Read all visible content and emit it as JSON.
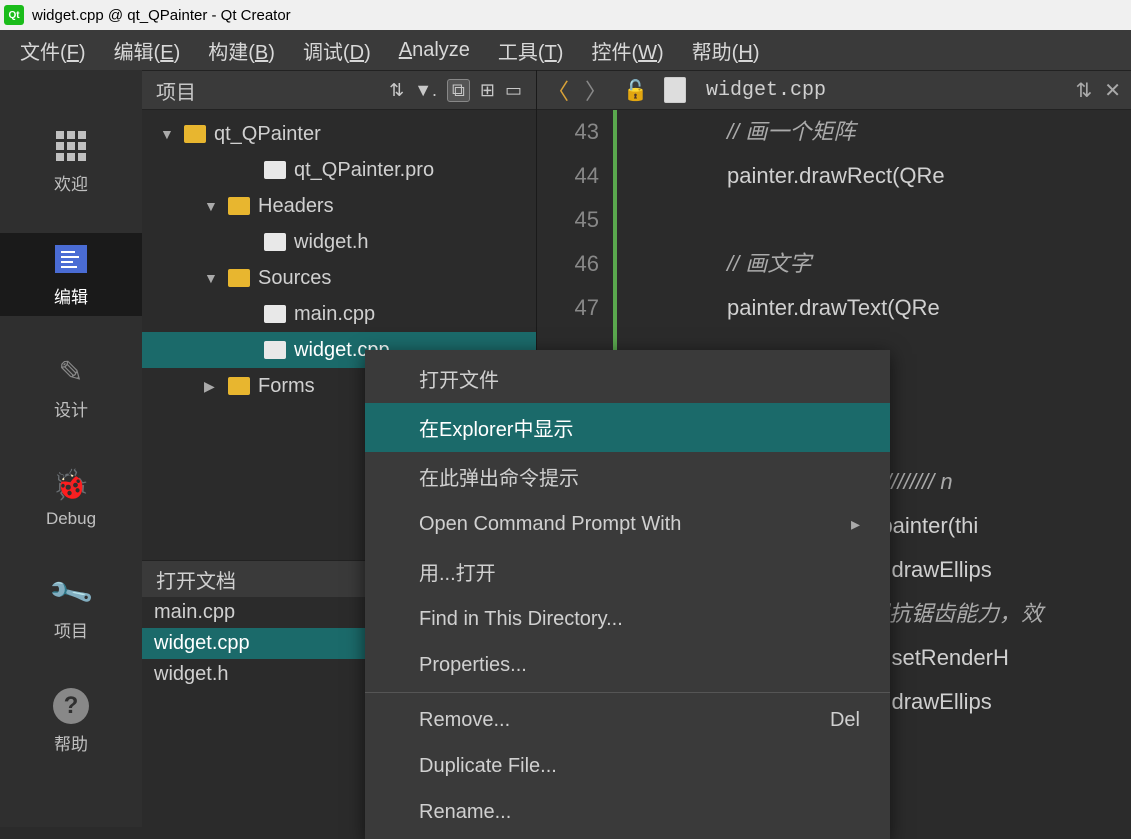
{
  "titlebar": {
    "text": "widget.cpp @ qt_QPainter - Qt Creator",
    "app_badge": "Qt"
  },
  "menubar": [
    {
      "label": "文件(F)",
      "u": "F"
    },
    {
      "label": "编辑(E)",
      "u": "E"
    },
    {
      "label": "构建(B)",
      "u": "B"
    },
    {
      "label": "调试(D)",
      "u": "D"
    },
    {
      "label": "Analyze",
      "u": "A"
    },
    {
      "label": "工具(T)",
      "u": "T"
    },
    {
      "label": "控件(W)",
      "u": "W"
    },
    {
      "label": "帮助(H)",
      "u": "H"
    }
  ],
  "sidebar": [
    {
      "id": "welcome",
      "label": "欢迎"
    },
    {
      "id": "edit",
      "label": "编辑"
    },
    {
      "id": "design",
      "label": "设计"
    },
    {
      "id": "debug",
      "label": "Debug"
    },
    {
      "id": "project",
      "label": "项目"
    },
    {
      "id": "help",
      "label": "帮助"
    }
  ],
  "sidebar_active": "edit",
  "project_panel": {
    "title": "项目",
    "tree": [
      {
        "level": 0,
        "arrow": "▼",
        "icon": "project",
        "color": "#e8b62f",
        "name": "qt_QPainter"
      },
      {
        "level": 2,
        "icon": "pro",
        "color": "#e8e8e8",
        "name": "qt_QPainter.pro"
      },
      {
        "level": 1,
        "arrow": "▼",
        "icon": "folder",
        "color": "#e8b62f",
        "name": "Headers"
      },
      {
        "level": 2,
        "icon": "h",
        "color": "#e8e8e8",
        "name": "widget.h"
      },
      {
        "level": 1,
        "arrow": "▼",
        "icon": "folder",
        "color": "#e8b62f",
        "name": "Sources"
      },
      {
        "level": 2,
        "icon": "cpp",
        "color": "#e8e8e8",
        "name": "main.cpp"
      },
      {
        "level": 2,
        "icon": "cpp",
        "color": "#e8e8e8",
        "name": "widget.cpp",
        "selected": true
      },
      {
        "level": 1,
        "arrow": "▶",
        "icon": "folder",
        "color": "#e8b62f",
        "name": "Forms"
      }
    ]
  },
  "open_docs": {
    "title": "打开文档",
    "items": [
      {
        "name": "main.cpp"
      },
      {
        "name": "widget.cpp",
        "selected": true
      },
      {
        "name": "widget.h"
      }
    ]
  },
  "editor": {
    "filename": "widget.cpp",
    "lines": [
      {
        "n": 43,
        "text": "// 画一个矩阵",
        "cls": "comment"
      },
      {
        "n": 44,
        "text": "painter.drawRect(QRe"
      },
      {
        "n": 45,
        "text": ""
      },
      {
        "n": 46,
        "text": "// 画文字",
        "cls": "comment"
      },
      {
        "n": 47,
        "text": "painter.drawText(QRe"
      }
    ],
    "tail_fragments": [
      "/////////// n",
      "r painter(thi",
      "er.drawEllips",
      "置抗锯齿能力，效",
      "er.setRenderH",
      "er.drawEllips"
    ]
  },
  "context_menu": {
    "items": [
      {
        "label": "打开文件"
      },
      {
        "label": "在Explorer中显示",
        "hover": true
      },
      {
        "label": "在此弹出命令提示"
      },
      {
        "label": "Open Command Prompt With",
        "submenu": true
      },
      {
        "label": "用...打开"
      },
      {
        "label": "Find in This Directory..."
      },
      {
        "label": "Properties..."
      },
      {
        "sep": true
      },
      {
        "label": "Remove...",
        "shortcut": "Del"
      },
      {
        "label": "Duplicate File..."
      },
      {
        "label": "Rename..."
      }
    ]
  }
}
